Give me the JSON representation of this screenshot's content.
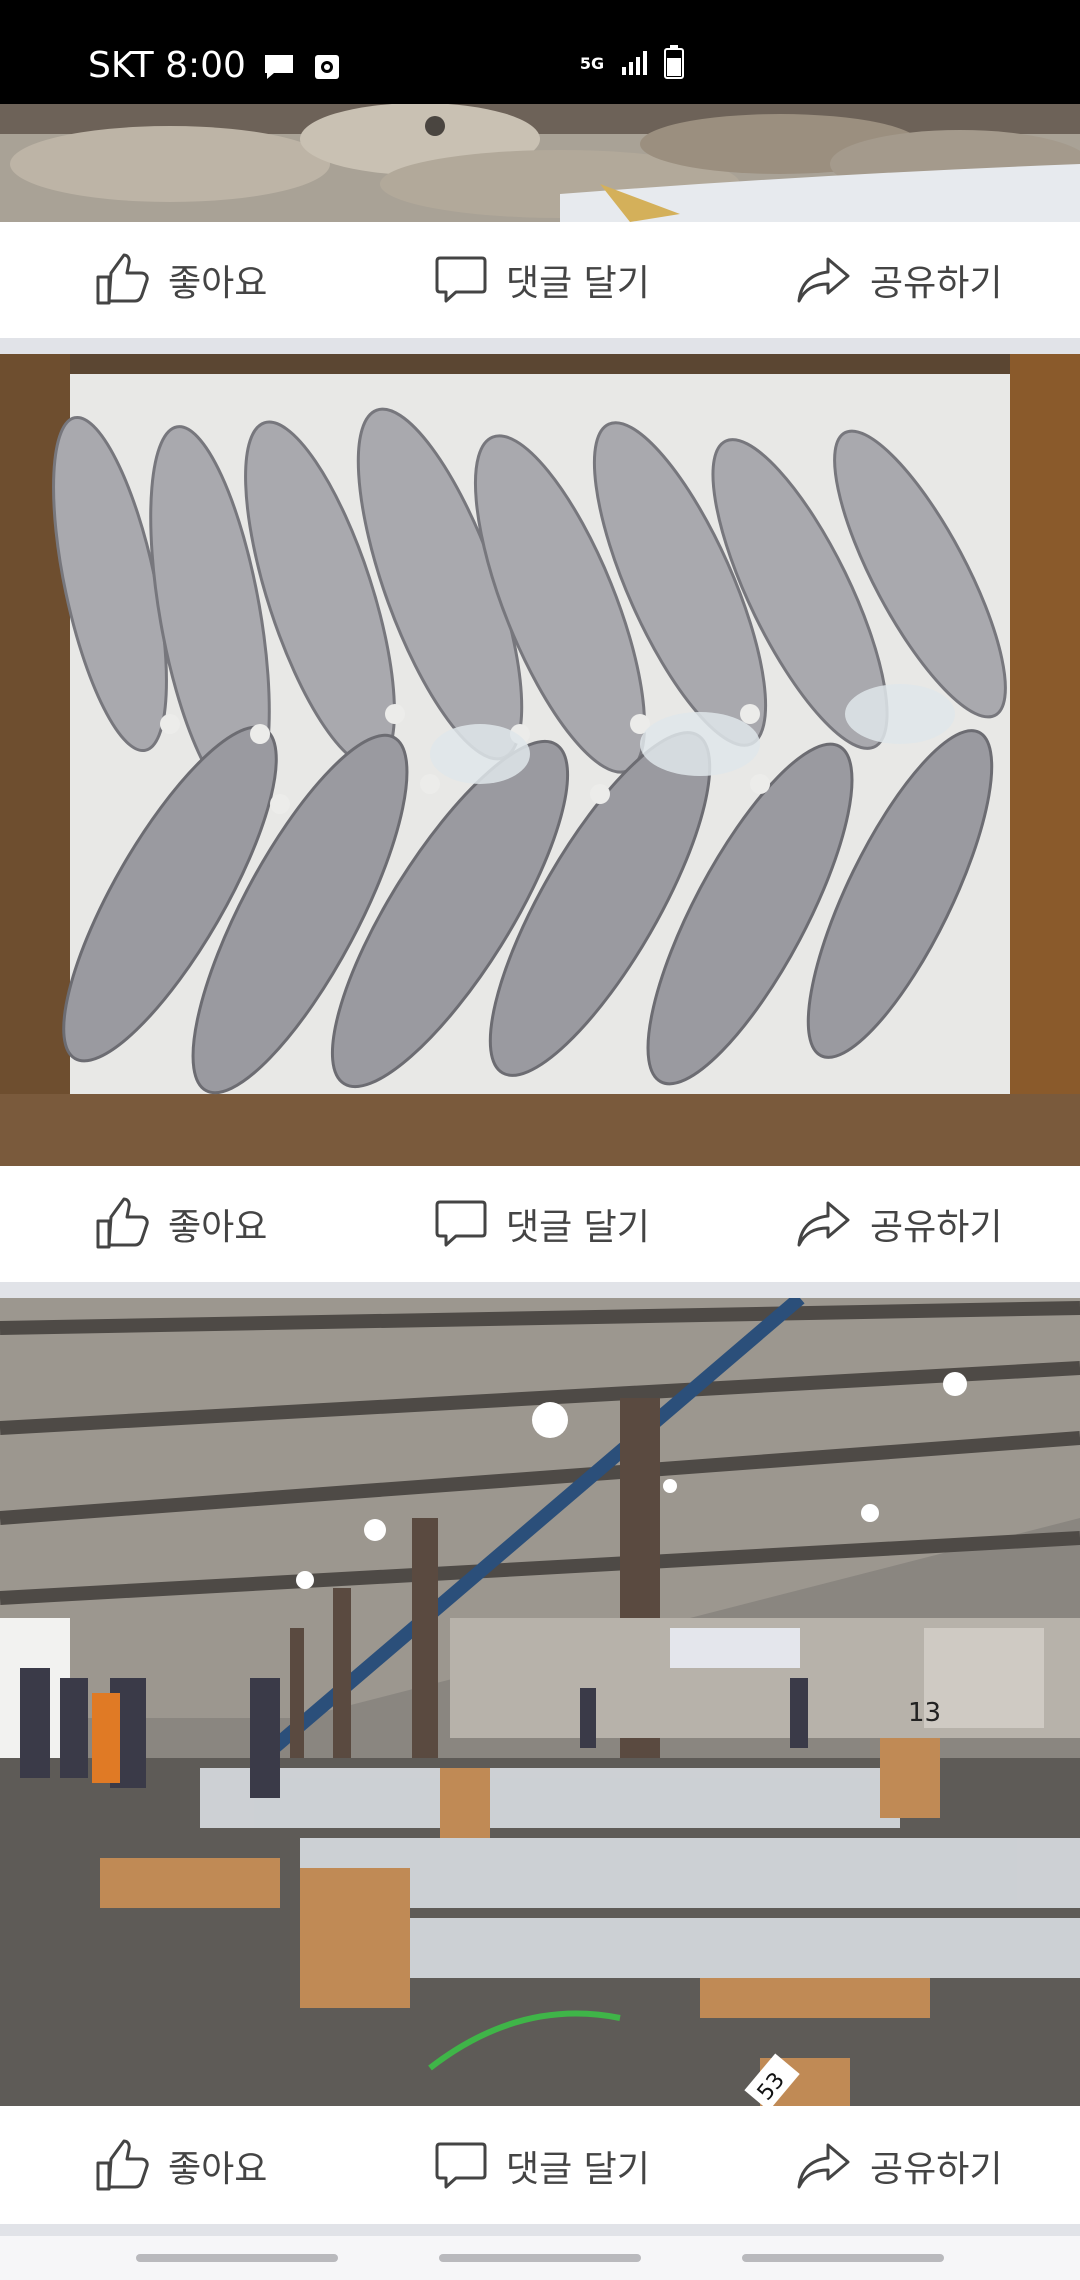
{
  "status_bar": {
    "carrier_time": "SKT 8:00",
    "network_badge": "5G",
    "icons": [
      "chat-bubble-icon",
      "screen-record-icon",
      "signal-icon",
      "battery-icon"
    ]
  },
  "colors": {
    "status_bar_bg": "#000000",
    "action_text": "#444444",
    "separator": "#e1e3e8",
    "nav_bar_bg": "#f6f6f8"
  },
  "feed": {
    "actions": {
      "like_label": "좋아요",
      "comment_label": "댓글 달기",
      "share_label": "공유하기"
    },
    "posts": [
      {
        "photo_subject": "fish pile (top cropped)",
        "icon": "fish-photo"
      },
      {
        "photo_subject": "box of fish on ice",
        "icon": "fish-photo"
      },
      {
        "photo_subject": "indoor fish market hall",
        "icon": "market-photo"
      }
    ]
  },
  "market_photo_text": {
    "stall_number": "13",
    "box_number": "53"
  }
}
